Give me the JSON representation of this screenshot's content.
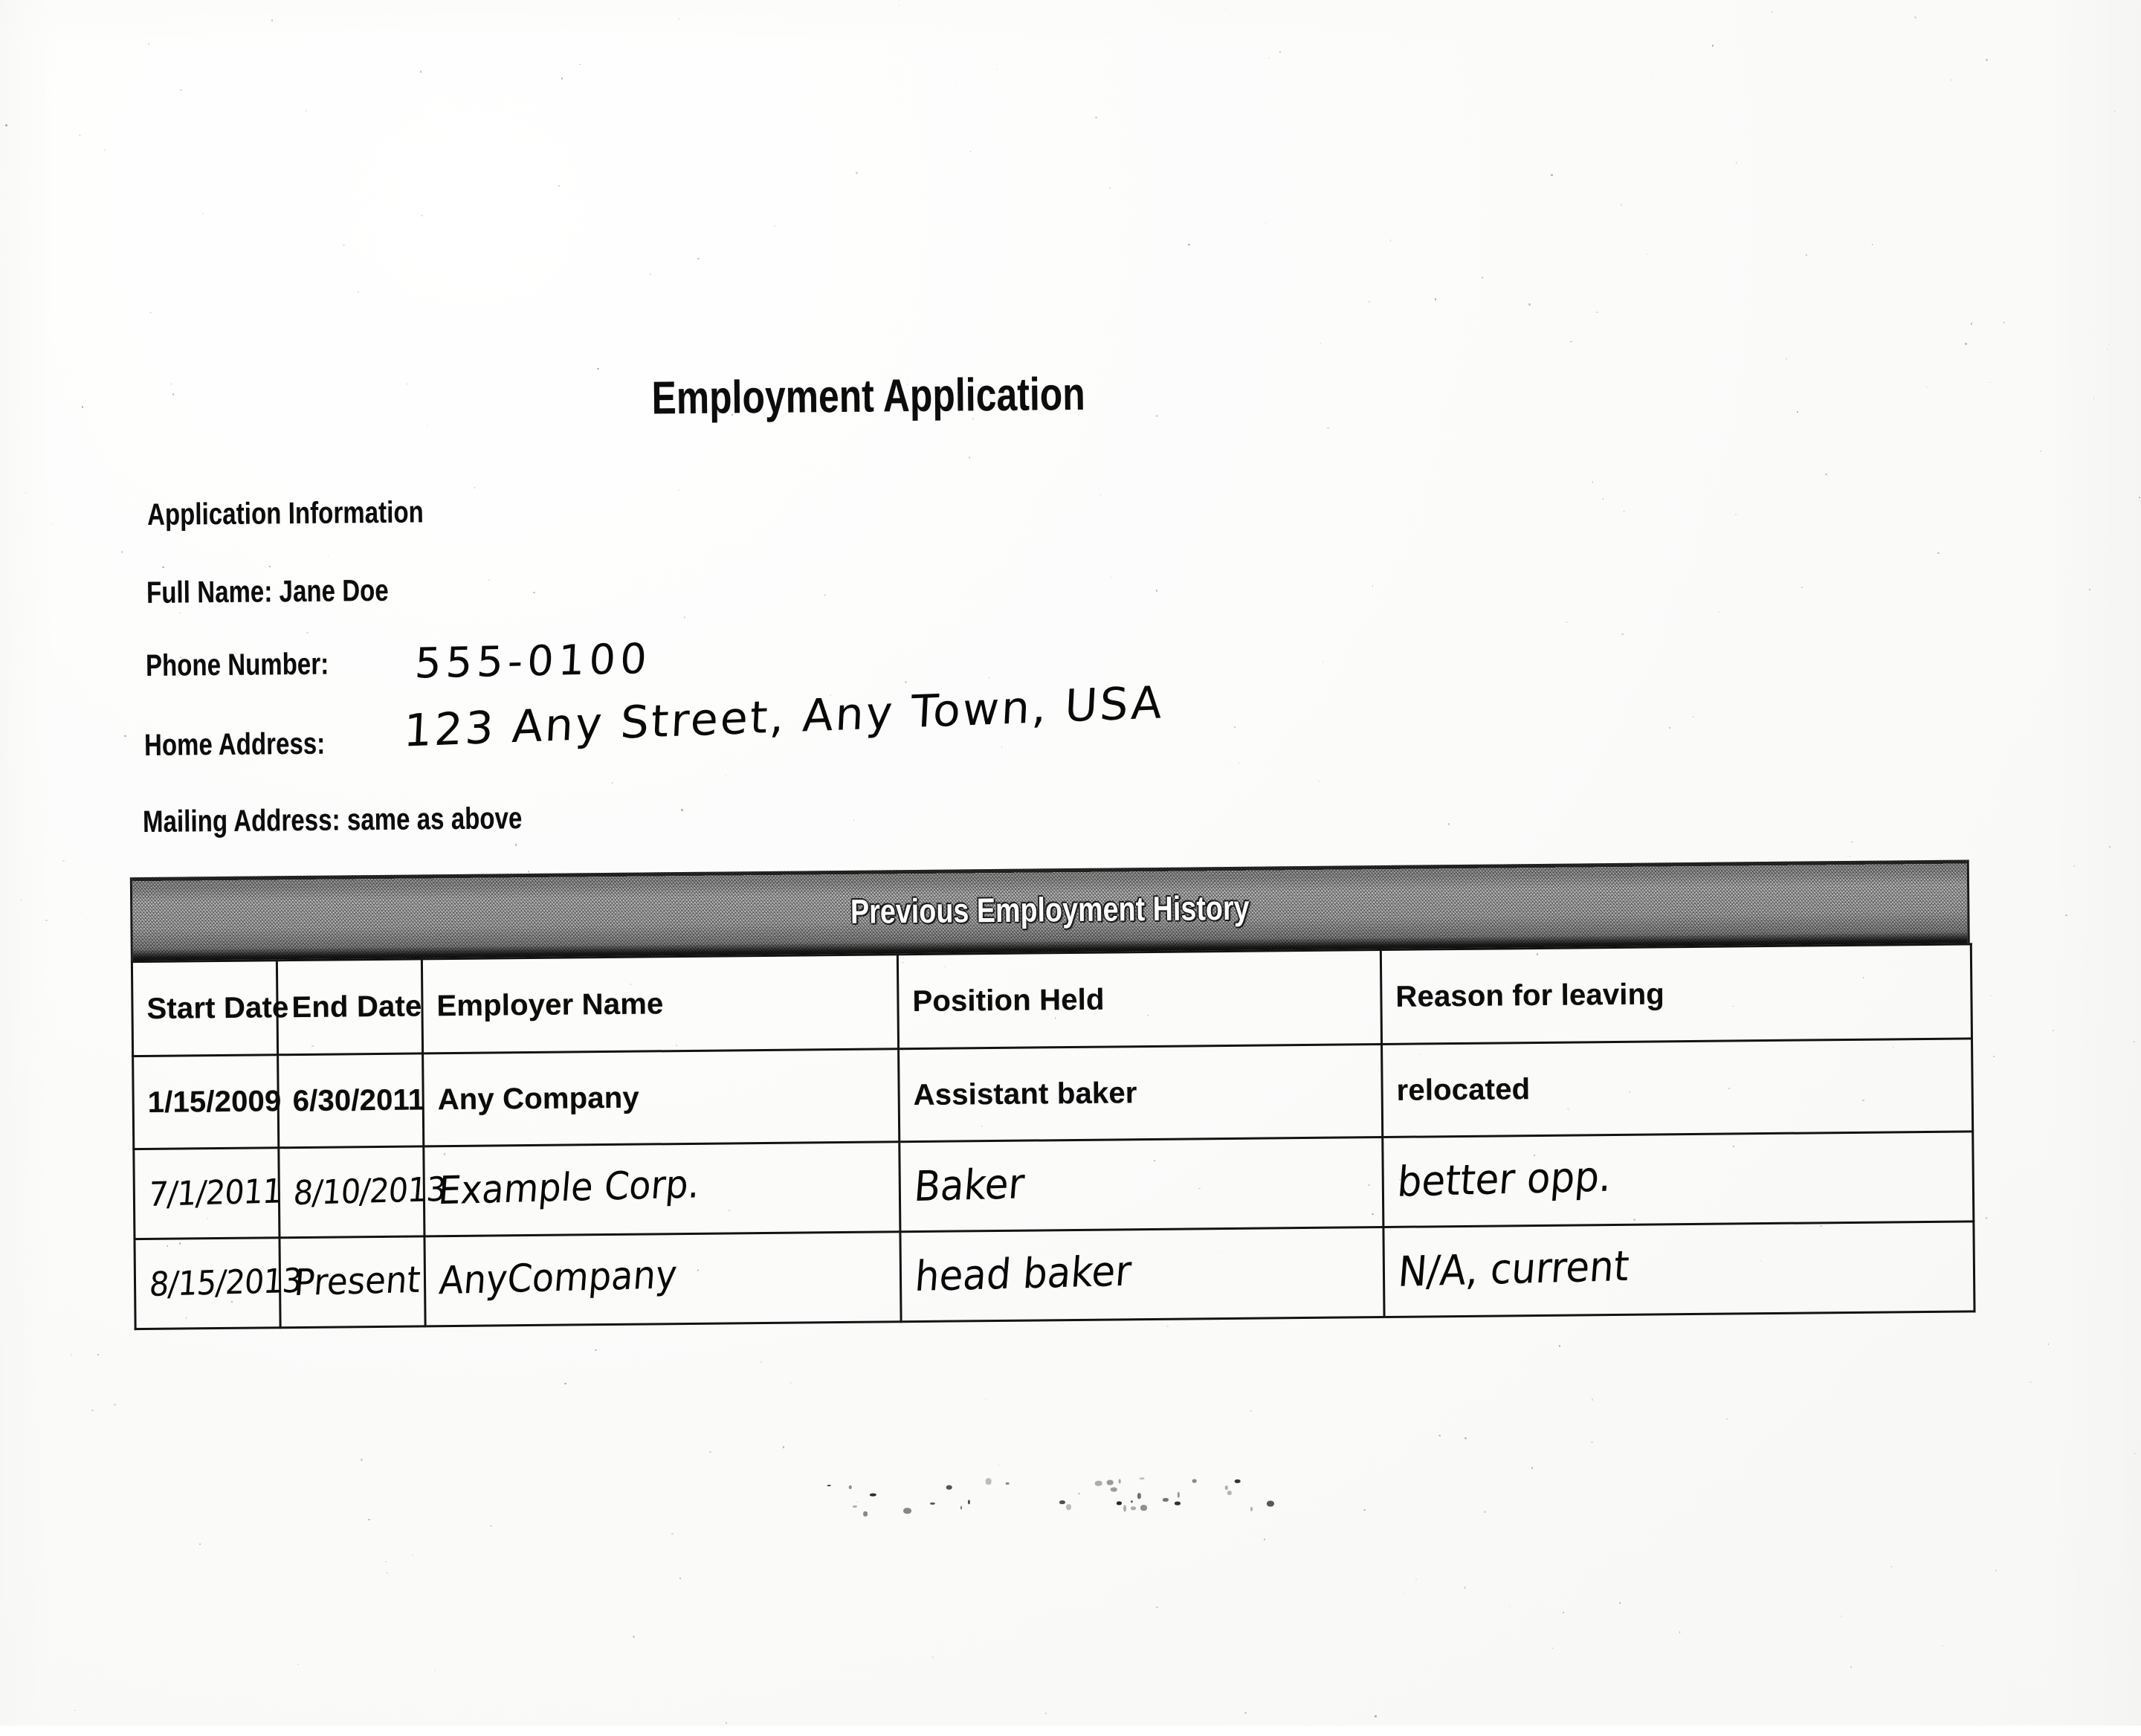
{
  "document": {
    "title": "Employment Application",
    "section_heading": "Application Information",
    "fields": {
      "full_name_label": "Full Name: Jane Doe",
      "phone_label": "Phone Number:",
      "phone_value": "555-0100",
      "home_address_label": "Home Address:",
      "home_address_value": "123 Any Street, Any Town, USA",
      "mailing_label": "Mailing Address: same as above"
    }
  },
  "table": {
    "banner_title": "Previous Employment History",
    "columns": [
      "Start Date",
      "End Date",
      "Employer Name",
      "Position Held",
      "Reason for leaving"
    ],
    "rows": [
      {
        "handwritten": false,
        "start_date": "1/15/2009",
        "end_date": "6/30/2011",
        "employer": "Any Company",
        "position": "Assistant baker",
        "reason": "relocated"
      },
      {
        "handwritten": true,
        "start_date": "7/1/2011",
        "end_date": "8/10/2013",
        "employer": "Example Corp.",
        "position": "Baker",
        "reason": "better opp."
      },
      {
        "handwritten": true,
        "start_date": "8/15/2013",
        "end_date": "Present",
        "employer": "AnyCompany",
        "position": "head baker",
        "reason": "N/A, current"
      }
    ]
  }
}
